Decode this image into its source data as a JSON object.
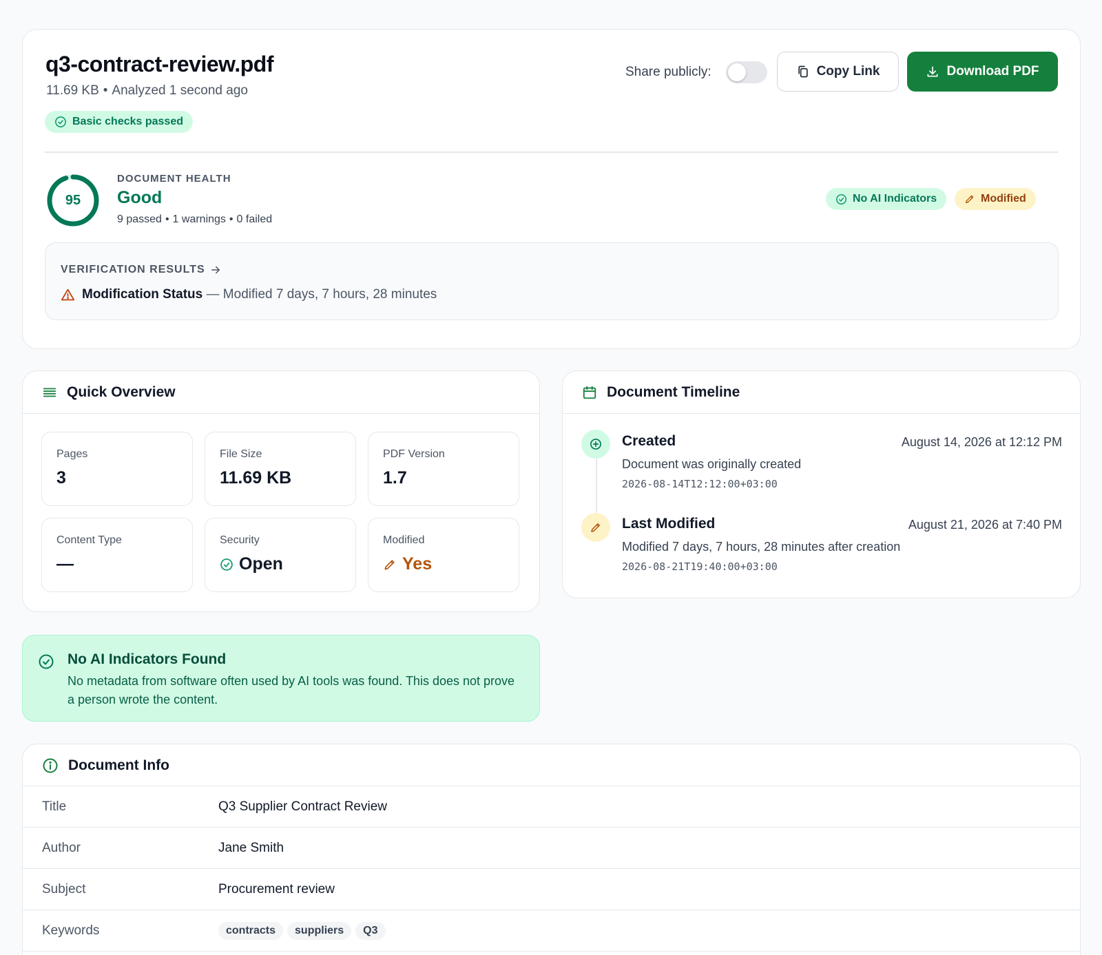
{
  "header": {
    "file_name": "q3-contract-review.pdf",
    "file_size": "11.69 KB",
    "analyzed": "Analyzed 1 second ago",
    "checks_badge": "Basic checks passed",
    "share_label": "Share publicly:",
    "share_enabled": false,
    "copy_link_label": "Copy Link",
    "download_label": "Download PDF"
  },
  "health": {
    "score": "95",
    "score_fraction": 0.95,
    "label": "DOCUMENT HEALTH",
    "status": "Good",
    "passed": "9 passed",
    "warnings": "1 warnings",
    "failed": "0 failed",
    "badges": {
      "no_ai": "No AI Indicators",
      "modified": "Modified"
    }
  },
  "verification": {
    "heading": "VERIFICATION RESULTS",
    "item_label": "Modification Status",
    "item_desc": "— Modified 7 days, 7 hours, 28 minutes"
  },
  "overview": {
    "title": "Quick Overview",
    "stats": [
      {
        "label": "Pages",
        "value": "3"
      },
      {
        "label": "File Size",
        "value": "11.69 KB"
      },
      {
        "label": "PDF Version",
        "value": "1.7"
      },
      {
        "label": "Content Type",
        "value": "—"
      },
      {
        "label": "Security",
        "value": "Open"
      },
      {
        "label": "Modified",
        "value": "Yes"
      }
    ]
  },
  "timeline": {
    "title": "Document Timeline",
    "events": [
      {
        "title": "Created",
        "date": "August 14, 2026 at 12:12 PM",
        "desc": "Document was originally created",
        "iso": "2026-08-14T12:12:00+03:00"
      },
      {
        "title": "Last Modified",
        "date": "August 21, 2026 at 7:40 PM",
        "desc": "Modified 7 days, 7 hours, 28 minutes after creation",
        "iso": "2026-08-21T19:40:00+03:00"
      }
    ]
  },
  "ai_banner": {
    "title": "No AI Indicators Found",
    "body": "No metadata from software often used by AI tools was found. This does not prove a person wrote the content."
  },
  "info": {
    "title": "Document Info",
    "rows": [
      {
        "key": "Title",
        "value": "Q3 Supplier Contract Review"
      },
      {
        "key": "Author",
        "value": "Jane Smith"
      },
      {
        "key": "Subject",
        "value": "Procurement review"
      },
      {
        "key": "Keywords",
        "tags": [
          "contracts",
          "suppliers",
          "Q3"
        ]
      }
    ]
  },
  "colors": {
    "accent_green": "#15803d",
    "success_text": "#047857",
    "warning_text": "#b45309",
    "success_bg": "#d1fae5",
    "warning_bg": "#fef3c7"
  },
  "icons": {
    "copy": "copy-icon",
    "download": "download-icon",
    "check_circle": "check-circle-icon",
    "pencil": "pencil-icon",
    "warning": "warning-triangle-icon",
    "arrow": "arrow-right-icon",
    "list": "list-icon",
    "calendar": "calendar-icon",
    "plus_circle": "plus-circle-icon",
    "info": "info-icon"
  }
}
